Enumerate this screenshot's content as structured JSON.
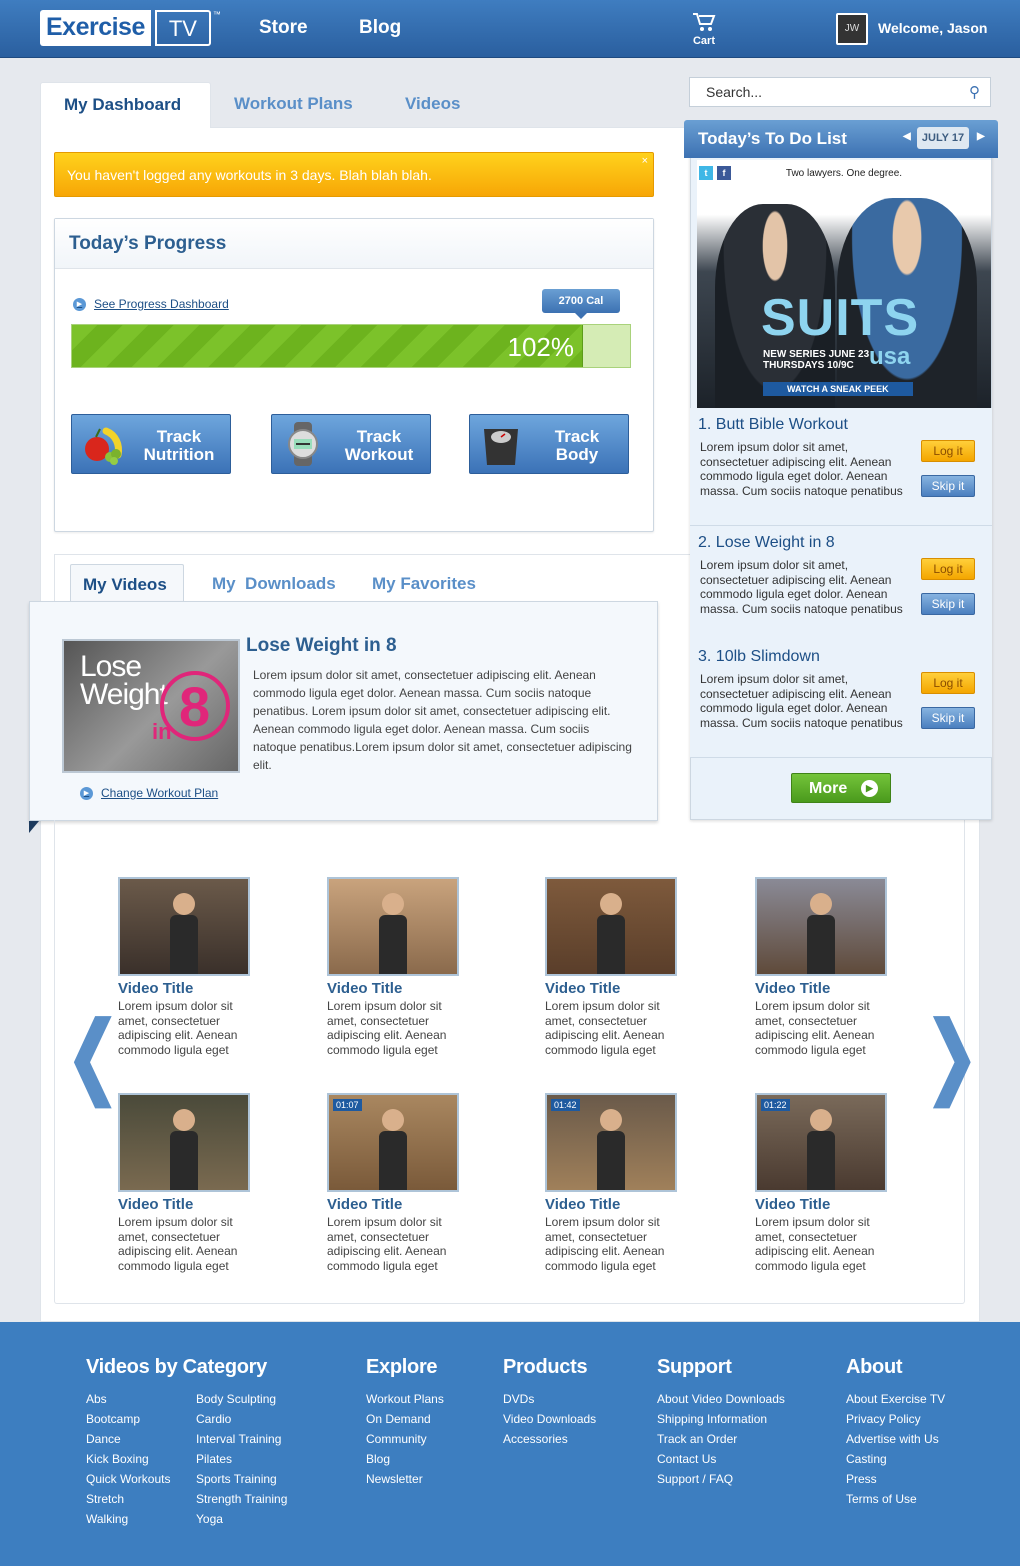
{
  "header": {
    "logo_left": "Exercise",
    "logo_right": "TV",
    "logo_tm": "™",
    "nav": [
      "Store",
      "Blog"
    ],
    "cart_label": "Cart",
    "avatar_initials": "JW",
    "welcome": "Welcome, Jason"
  },
  "tabs": [
    "My Dashboard",
    "Workout Plans",
    "Videos"
  ],
  "alert": {
    "text": "You haven't logged any workouts in 3 days. Blah blah blah.",
    "close": "×"
  },
  "progress": {
    "title": "Today’s Progress",
    "link": "See Progress Dashboard",
    "calories": "2700 Cal",
    "percent_label": "102%",
    "fill_fraction": 0.915,
    "track_buttons": [
      {
        "line1": "Track",
        "line2": "Nutrition",
        "icon": "fruit-icon"
      },
      {
        "line1": "Track",
        "line2": "Workout",
        "icon": "watch-icon"
      },
      {
        "line1": "Track",
        "line2": "Body",
        "icon": "scale-icon"
      }
    ]
  },
  "video_tabs": [
    "My Videos",
    "My  Downloads",
    "My Favorites"
  ],
  "plan": {
    "thumb_line1": "Lose",
    "thumb_line2": "Weight",
    "thumb_in": "in",
    "thumb_8": "8",
    "title": "Lose Weight in 8",
    "description": "Lorem ipsum dolor sit amet, consectetuer adipiscing elit. Aenean commodo ligula eget dolor. Aenean massa. Cum sociis natoque penatibus. Lorem ipsum dolor sit amet, consectetuer adipiscing elit. Aenean commodo ligula eget dolor. Aenean massa. Cum sociis natoque penatibus.Lorem ipsum dolor sit amet, consectetuer adipiscing elit.",
    "link": "Change Workout Plan"
  },
  "videos": [
    {
      "title": "Video Title",
      "desc": "Lorem ipsum dolor sit amet, consectetuer adipiscing elit. Aenean commodo ligula eget",
      "time": ""
    },
    {
      "title": "Video Title",
      "desc": "Lorem ipsum dolor sit amet, consectetuer adipiscing elit. Aenean commodo ligula eget",
      "time": ""
    },
    {
      "title": "Video Title",
      "desc": "Lorem ipsum dolor sit amet, consectetuer adipiscing elit. Aenean commodo ligula eget",
      "time": ""
    },
    {
      "title": "Video Title",
      "desc": "Lorem ipsum dolor sit amet, consectetuer adipiscing elit. Aenean commodo ligula eget",
      "time": ""
    },
    {
      "title": "Video Title",
      "desc": "Lorem ipsum dolor sit amet, consectetuer adipiscing elit. Aenean commodo ligula eget",
      "time": ""
    },
    {
      "title": "Video Title",
      "desc": "Lorem ipsum dolor sit amet, consectetuer adipiscing elit. Aenean commodo ligula eget",
      "time": "01:07"
    },
    {
      "title": "Video Title",
      "desc": "Lorem ipsum dolor sit amet, consectetuer adipiscing elit. Aenean commodo ligula eget",
      "time": "01:42"
    },
    {
      "title": "Video Title",
      "desc": "Lorem ipsum dolor sit amet, consectetuer adipiscing elit. Aenean commodo ligula eget",
      "time": "01:22"
    }
  ],
  "carousel": {
    "prev": "❮",
    "next": "❯"
  },
  "sidebar": {
    "search_placeholder": "Search...",
    "todo_title": "Today’s To Do List",
    "date": "JULY 17",
    "ad": {
      "tagline": "Two lawyers. One degree.",
      "title": "SUITS",
      "network": "usa",
      "line1": "NEW SERIES JUNE 23",
      "line2": "THURSDAYS 10/9C",
      "cta": "WATCH A SNEAK PEEK"
    },
    "todos": [
      {
        "title": "1. Butt Bible Workout",
        "desc": "Lorem ipsum dolor sit amet, consectetuer adipiscing elit. Aenean commodo ligula eget dolor. Aenean massa. Cum sociis natoque penatibus",
        "log": "Log it",
        "skip": "Skip it"
      },
      {
        "title": "2. Lose Weight in 8",
        "desc": "Lorem ipsum dolor sit amet, consectetuer adipiscing elit. Aenean commodo ligula eget dolor. Aenean massa. Cum sociis natoque penatibus",
        "log": "Log it",
        "skip": "Skip it"
      },
      {
        "title": "3. 10lb Slimdown",
        "desc": "Lorem ipsum dolor sit amet, consectetuer adipiscing elit. Aenean commodo ligula eget dolor. Aenean massa. Cum sociis natoque penatibus",
        "log": "Log it",
        "skip": "Skip it"
      }
    ],
    "more": "More"
  },
  "footer": {
    "categories": {
      "title": "Videos by Category",
      "col1": [
        "Abs",
        "Bootcamp",
        "Dance",
        "Kick Boxing",
        "Quick Workouts",
        "Stretch",
        "Walking"
      ],
      "col2": [
        "Body Sculpting",
        "Cardio",
        "Interval Training",
        "Pilates",
        "Sports Training",
        "Strength Training",
        "Yoga"
      ]
    },
    "explore": {
      "title": "Explore",
      "items": [
        "Workout Plans",
        "On Demand",
        "Community",
        "Blog",
        "Newsletter"
      ]
    },
    "products": {
      "title": "Products",
      "items": [
        "DVDs",
        "Video Downloads",
        "Accessories"
      ]
    },
    "support": {
      "title": "Support",
      "items": [
        "About Video Downloads",
        "Shipping Information",
        "Track an Order",
        "Contact Us",
        "Support / FAQ"
      ]
    },
    "about": {
      "title": "About",
      "items": [
        "About Exercise TV",
        "Privacy Policy",
        "Advertise with Us",
        "Casting",
        "Press",
        "Terms of Use"
      ]
    }
  },
  "colors": {
    "header_blue": "#2a5f9f",
    "accent_blue": "#3c71b2",
    "alert_yellow": "#f7a606",
    "progress_green": "#7cc22a",
    "footer_blue": "#3d7ec0"
  }
}
